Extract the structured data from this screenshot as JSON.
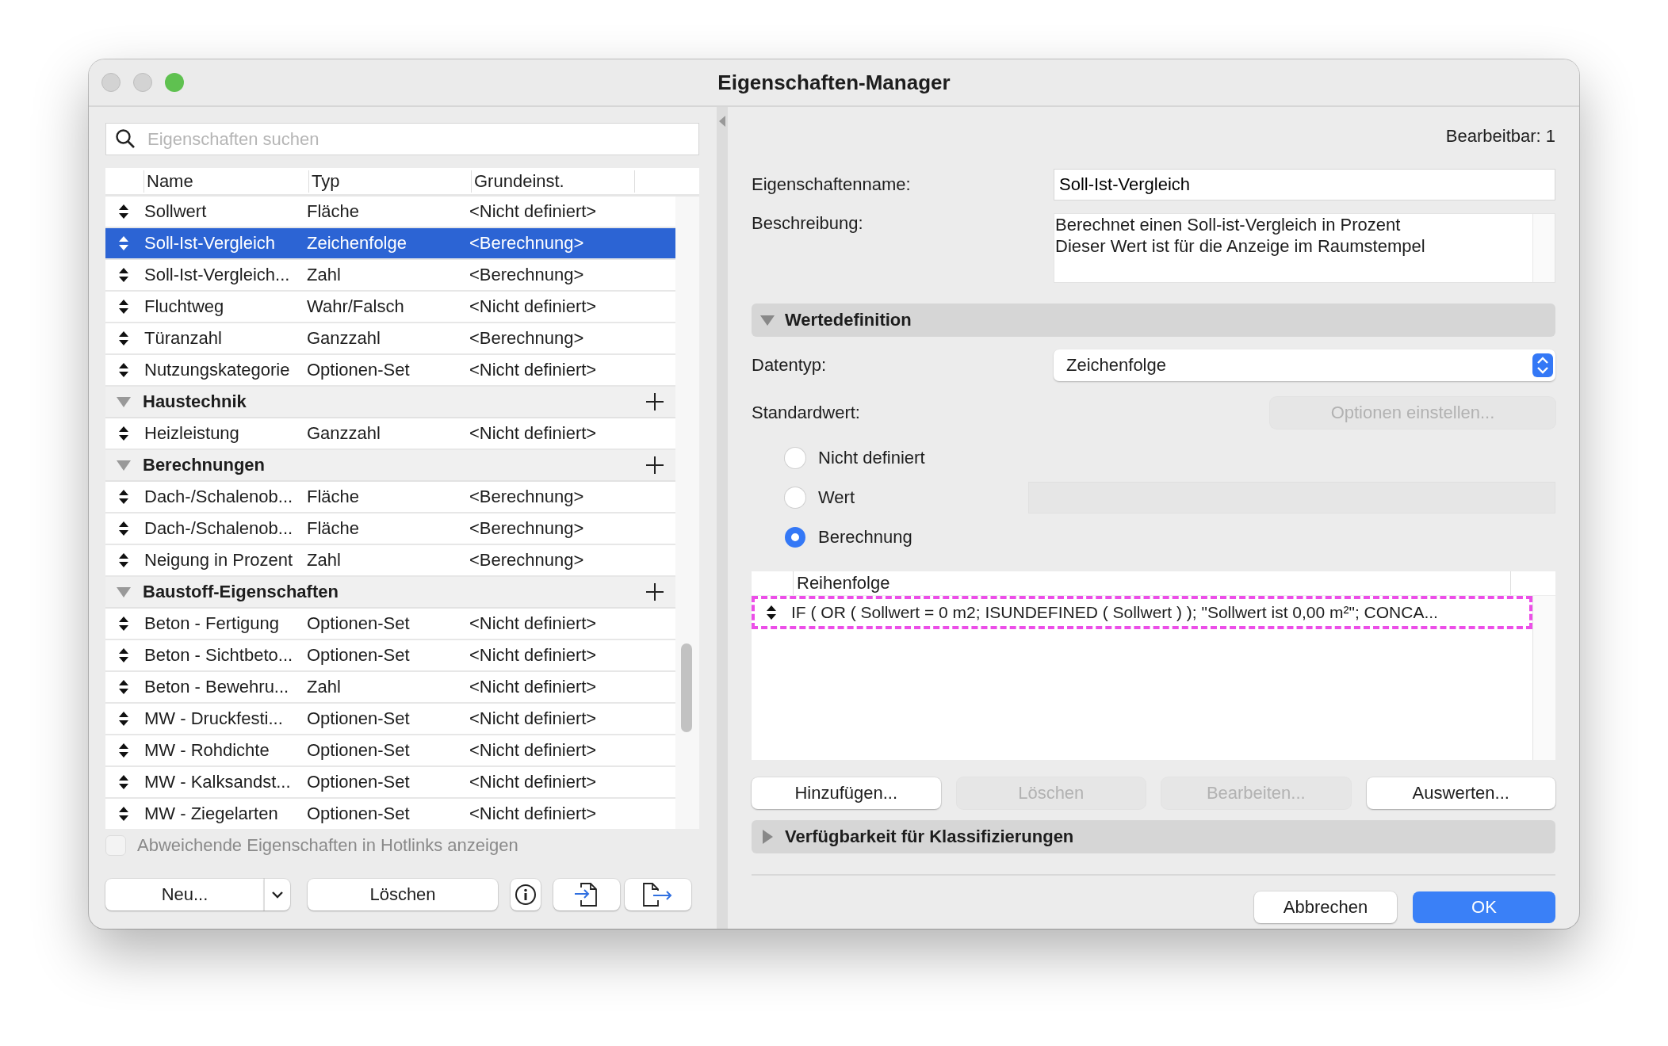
{
  "window": {
    "title": "Eigenschaften-Manager"
  },
  "search": {
    "placeholder": "Eigenschaften suchen"
  },
  "table": {
    "columns": [
      "Name",
      "Typ",
      "Grundeinst."
    ],
    "rows": [
      {
        "kind": "property",
        "name": "Sollwert",
        "type": "Fläche",
        "default": "<Nicht definiert>",
        "selected": false
      },
      {
        "kind": "property",
        "name": "Soll-Ist-Vergleich",
        "type": "Zeichenfolge",
        "default": "<Berechnung>",
        "selected": true
      },
      {
        "kind": "property",
        "name": "Soll-Ist-Vergleich...",
        "type": "Zahl",
        "default": "<Berechnung>",
        "selected": false
      },
      {
        "kind": "property",
        "name": "Fluchtweg",
        "type": "Wahr/Falsch",
        "default": "<Nicht definiert>",
        "selected": false
      },
      {
        "kind": "property",
        "name": "Türanzahl",
        "type": "Ganzzahl",
        "default": "<Berechnung>",
        "selected": false
      },
      {
        "kind": "property",
        "name": "Nutzungskategorie",
        "type": "Optionen-Set",
        "default": "<Nicht definiert>",
        "selected": false
      },
      {
        "kind": "group",
        "name": "Haustechnik",
        "expanded": true,
        "children": [
          {
            "name": "Heizleistung",
            "type": "Ganzzahl",
            "default": "<Nicht definiert>",
            "selected": false
          }
        ]
      },
      {
        "kind": "group",
        "name": "Berechnungen",
        "expanded": true,
        "children": [
          {
            "name": "Dach-/Schalenob...",
            "type": "Fläche",
            "default": "<Berechnung>",
            "selected": false
          },
          {
            "name": "Dach-/Schalenob...",
            "type": "Fläche",
            "default": "<Berechnung>",
            "selected": false
          },
          {
            "name": "Neigung in Prozent",
            "type": "Zahl",
            "default": "<Berechnung>",
            "selected": false
          }
        ]
      },
      {
        "kind": "group",
        "name": "Baustoff-Eigenschaften",
        "expanded": true,
        "children": [
          {
            "name": "Beton - Fertigung",
            "type": "Optionen-Set",
            "default": "<Nicht definiert>",
            "selected": false
          },
          {
            "name": "Beton - Sichtbeto...",
            "type": "Optionen-Set",
            "default": "<Nicht definiert>",
            "selected": false
          },
          {
            "name": "Beton - Bewehru...",
            "type": "Zahl",
            "default": "<Nicht definiert>",
            "selected": false
          },
          {
            "name": "MW - Druckfesti...",
            "type": "Optionen-Set",
            "default": "<Nicht definiert>",
            "selected": false
          },
          {
            "name": "MW - Rohdichte",
            "type": "Optionen-Set",
            "default": "<Nicht definiert>",
            "selected": false
          },
          {
            "name": "MW - Kalksandst...",
            "type": "Optionen-Set",
            "default": "<Nicht definiert>",
            "selected": false
          },
          {
            "name": "MW - Ziegelarten",
            "type": "Optionen-Set",
            "default": "<Nicht definiert>",
            "selected": false
          }
        ]
      }
    ]
  },
  "hotlinks_checkbox": {
    "label": "Abweichende Eigenschaften in Hotlinks anzeigen",
    "checked": false
  },
  "left_buttons": {
    "new": "Neu...",
    "delete": "Löschen"
  },
  "editable_count": "Bearbeitbar: 1",
  "fields": [
    {
      "label": "Eigenschaftenname:",
      "value": "Soll-Ist-Vergleich"
    },
    {
      "label": "Beschreibung:",
      "value": "Berechnet einen Soll-ist-Vergleich in Prozent\nDieser Wert ist für die Anzeige im Raumstempel"
    }
  ],
  "value_definition": {
    "title": "Wertedefinition",
    "expanded": true,
    "datatype": {
      "label": "Datentyp:",
      "value": "Zeichenfolge"
    },
    "default_label": "Standardwert:",
    "options_button": {
      "label": "Optionen einstellen...",
      "disabled": true
    },
    "radios": [
      {
        "label": "Nicht definiert",
        "selected": false
      },
      {
        "label": "Wert",
        "selected": false
      },
      {
        "label": "Berechnung",
        "selected": true
      }
    ],
    "formula_table": {
      "column": "Reihenfolge",
      "rows": [
        {
          "text": "IF ( OR ( Sollwert = 0 m2; ISUNDEFINED ( Sollwert ) ); \"Sollwert ist 0,00 m²\"; CONCA...",
          "highlighted": true
        }
      ]
    },
    "buttons": [
      {
        "label": "Hinzufügen...",
        "disabled": false
      },
      {
        "label": "Löschen",
        "disabled": true
      },
      {
        "label": "Bearbeiten...",
        "disabled": true
      },
      {
        "label": "Auswerten...",
        "disabled": false
      }
    ]
  },
  "classification": {
    "title": "Verfügbarkeit für Klassifizierungen",
    "expanded": false
  },
  "dialog_buttons": [
    {
      "label": "Abbrechen",
      "kind": "secondary"
    },
    {
      "label": "OK",
      "kind": "primary"
    }
  ]
}
